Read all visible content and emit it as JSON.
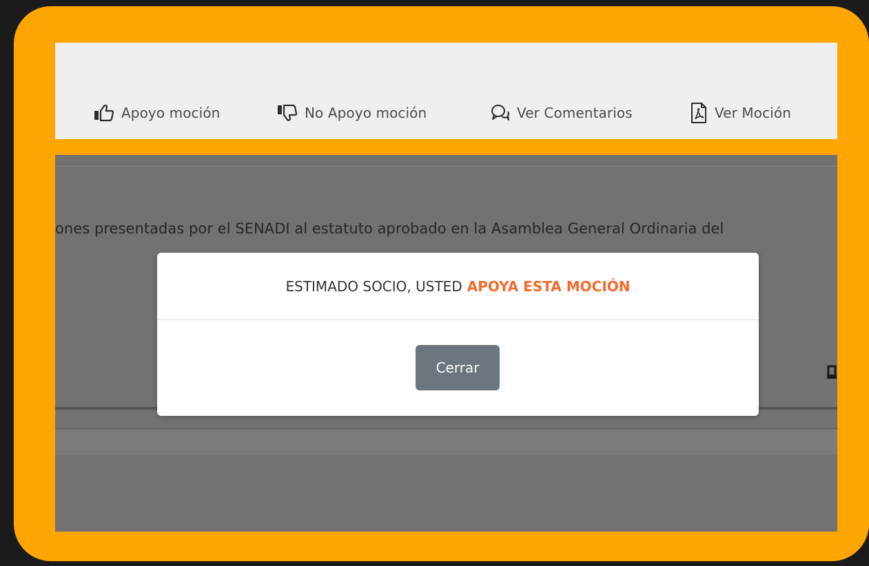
{
  "toolbar": {
    "items": [
      {
        "label": "Apoyo moción",
        "icon": "thumbs-up-icon"
      },
      {
        "label": "No Apoyo moción",
        "icon": "thumbs-down-icon"
      },
      {
        "label": "Ver Comentarios",
        "icon": "comments-icon"
      },
      {
        "label": "Ver Moción",
        "icon": "pdf-file-icon"
      }
    ]
  },
  "background": {
    "motion_text": "ones presentadas por el SENADI al estatuto aprobado en la Asamblea General Ordinaria del"
  },
  "modal": {
    "message_prefix": "ESTIMADO SOCIO, USTED",
    "message_highlight": "APOYA ESTA MOCIÓN",
    "close_label": "Cerrar"
  },
  "colors": {
    "frame": "#ffa500",
    "highlight": "#f26b2c",
    "close_button": "#6c757d"
  }
}
